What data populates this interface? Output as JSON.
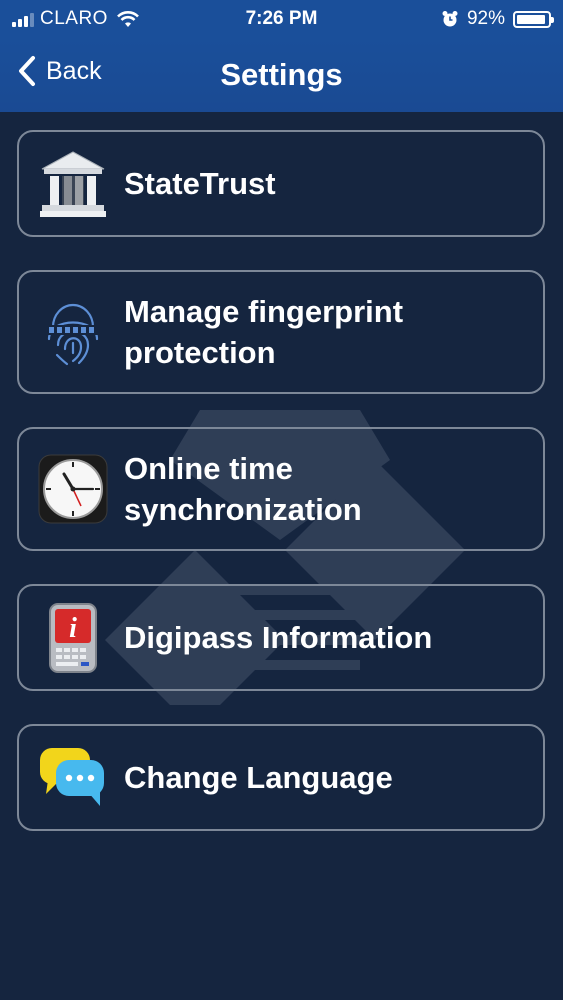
{
  "status_bar": {
    "carrier": "CLARO",
    "time": "7:26 PM",
    "battery": "92%",
    "battery_level": 0.92,
    "icons": [
      "signal-icon",
      "wifi-icon",
      "alarm-icon",
      "battery-icon"
    ]
  },
  "nav": {
    "back_label": "Back",
    "title": "Settings"
  },
  "items": [
    {
      "label": "StateTrust",
      "icon": "bank-icon"
    },
    {
      "label": "Manage fingerprint protection",
      "icon": "fingerprint-icon"
    },
    {
      "label": "Online time synchronization",
      "icon": "clock-icon"
    },
    {
      "label": "Digipass Information",
      "icon": "info-device-icon"
    },
    {
      "label": "Change Language",
      "icon": "chat-bubbles-icon"
    }
  ],
  "colors": {
    "bar": "#1a4f9a",
    "background": "#15253f",
    "row_border": "#7d8898"
  }
}
